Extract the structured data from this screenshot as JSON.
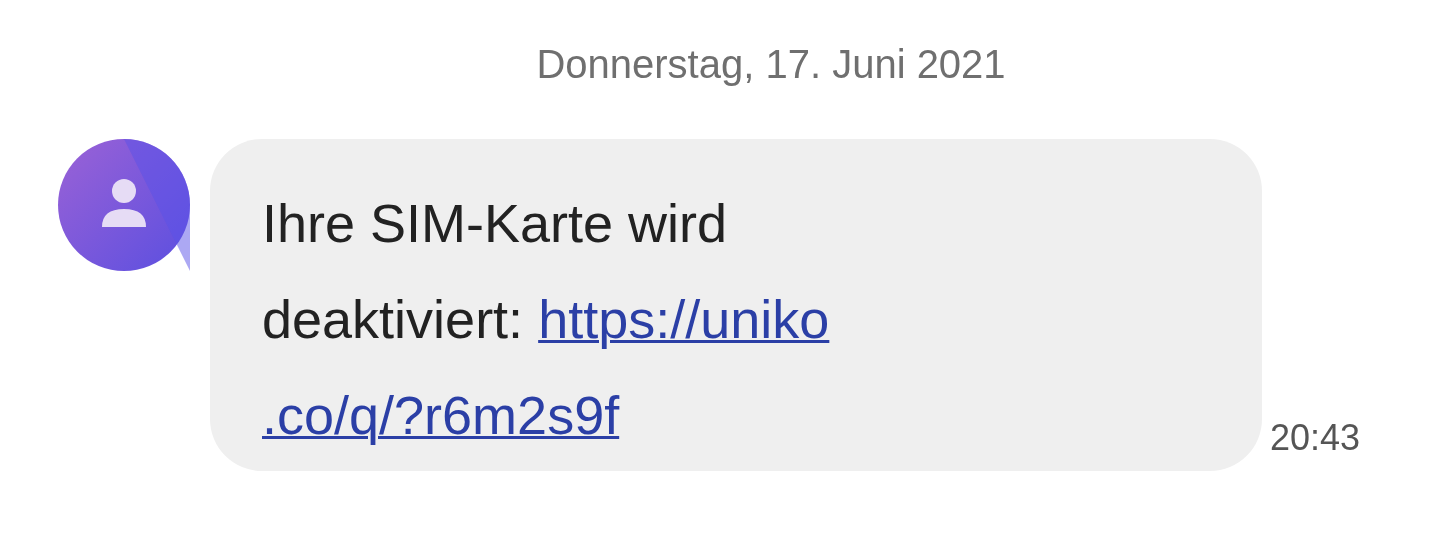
{
  "date_header": "Donnerstag, 17. Juni 2021",
  "message": {
    "text_line_1": "Ihre SIM-Karte wird",
    "text_line_2_prefix": "deaktiviert:",
    "link_parts": [
      "https://uniko",
      ".co/q/?r6m2s9f"
    ],
    "time": "20:43"
  }
}
